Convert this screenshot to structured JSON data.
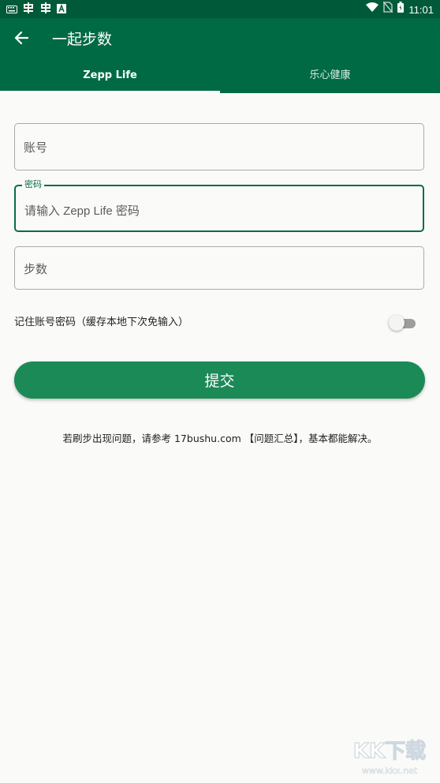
{
  "status_bar": {
    "left_icons": [
      "keyboard-icon",
      "app-icon",
      "app-icon",
      "a-icon"
    ],
    "time": "11:01",
    "right_icons": [
      "wifi-icon",
      "no-sim-icon",
      "battery-icon"
    ]
  },
  "app_bar": {
    "title": "一起步数",
    "tabs": [
      {
        "label": "Zepp Life",
        "active": true
      },
      {
        "label": "乐心健康",
        "active": false
      }
    ]
  },
  "form": {
    "account_placeholder": "账号",
    "password_label": "密码",
    "password_placeholder": "请输入 Zepp Life 密码",
    "steps_placeholder": "步数",
    "remember_label": "记住账号密码（缓存本地下次免输入）",
    "remember_enabled": false,
    "submit_label": "提交"
  },
  "help_text": "若刷步出现问题，请参考 17bushu.com 【问题汇总】，基本都能解决。",
  "watermark": {
    "logo_text": "KK下载",
    "url": "www.kkx.net"
  },
  "colors": {
    "status_bar": "#005a39",
    "app_bar": "#006a45",
    "accent": "#0b6b48",
    "button": "#1b8a57",
    "background": "#fafbf8"
  }
}
